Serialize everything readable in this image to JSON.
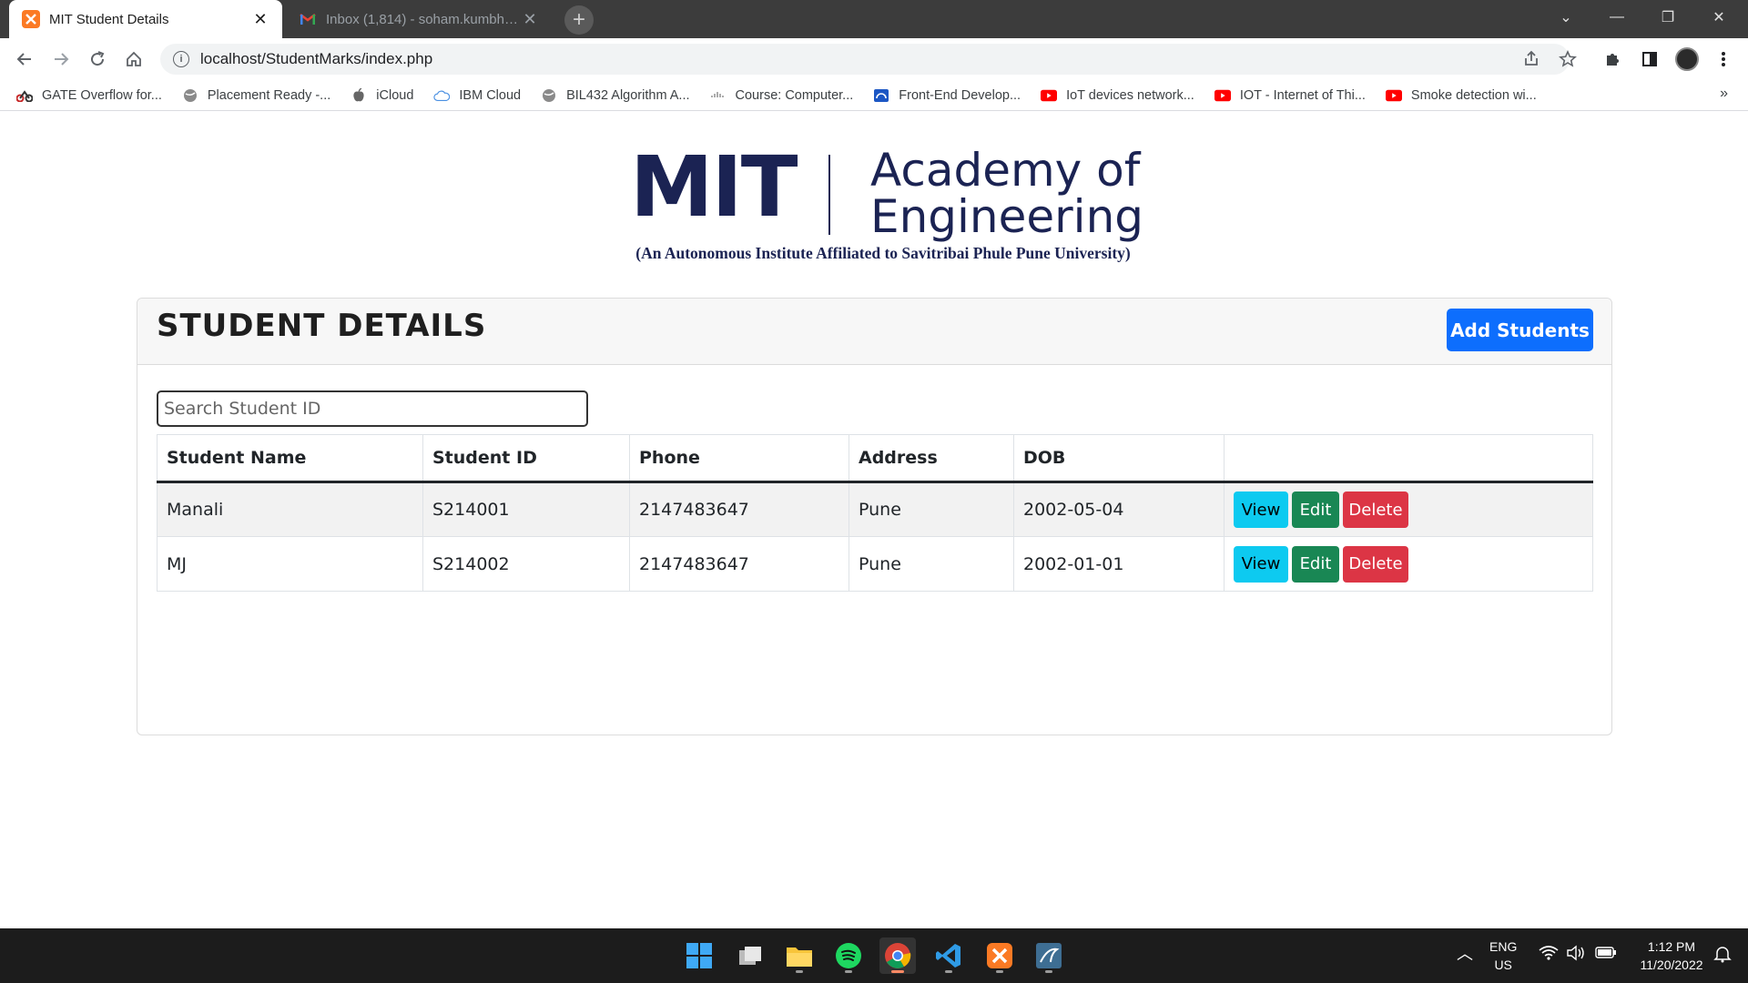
{
  "browser": {
    "tabs": [
      {
        "title": "MIT Student Details",
        "favicon": "xampp-icon",
        "active": true
      },
      {
        "title": "Inbox (1,814) - soham.kumbhar@",
        "favicon": "gmail-icon",
        "active": false
      }
    ],
    "url": "localhost/StudentMarks/index.php",
    "bookmarks": [
      {
        "label": "GATE Overflow for...",
        "icon": "gate-overflow-icon"
      },
      {
        "label": "Placement Ready -...",
        "icon": "globe-icon"
      },
      {
        "label": "iCloud",
        "icon": "apple-icon"
      },
      {
        "label": "IBM Cloud",
        "icon": "cloud-icon"
      },
      {
        "label": "BIL432 Algorithm A...",
        "icon": "globe-icon"
      },
      {
        "label": "Course: Computer...",
        "icon": "cisco-icon"
      },
      {
        "label": "Front-End Develop...",
        "icon": "coursera-icon"
      },
      {
        "label": "IoT devices network...",
        "icon": "youtube-icon"
      },
      {
        "label": "IOT - Internet of Thi...",
        "icon": "youtube-icon"
      },
      {
        "label": "Smoke detection wi...",
        "icon": "youtube-icon"
      }
    ],
    "bookmarks_more": "»"
  },
  "page": {
    "logo": {
      "mit": "MIT",
      "academy_line1": "Academy of",
      "academy_line2": "Engineering",
      "tagline": "(An Autonomous Institute Affiliated to Savitribai Phule Pune University)"
    },
    "card": {
      "title": "STUDENT DETAILS",
      "add_button": "Add Students",
      "search_placeholder": "Search Student ID",
      "columns": [
        "Student Name",
        "Student ID",
        "Phone",
        "Address",
        "DOB",
        ""
      ],
      "rows": [
        {
          "name": "Manali",
          "id": "S214001",
          "phone": "2147483647",
          "address": "Pune",
          "dob": "2002-05-04"
        },
        {
          "name": "MJ",
          "id": "S214002",
          "phone": "2147483647",
          "address": "Pune",
          "dob": "2002-01-01"
        }
      ],
      "actions": {
        "view": "View",
        "edit": "Edit",
        "delete": "Delete"
      }
    }
  },
  "taskbar": {
    "lang_line1": "ENG",
    "lang_line2": "US",
    "time": "1:12 PM",
    "date": "11/20/2022"
  },
  "colors": {
    "brand_navy": "#1b2353",
    "primary": "#0d6efd",
    "info": "#0dcaf0",
    "success": "#198754",
    "danger": "#dc3545"
  }
}
